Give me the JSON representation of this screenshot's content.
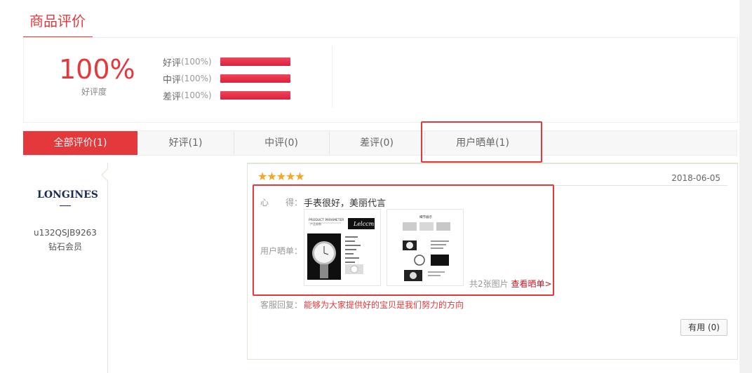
{
  "section": {
    "title": "商品评价"
  },
  "summary": {
    "rate": "100%",
    "rate_label": "好评度",
    "breakdown": [
      {
        "name": "好评",
        "pct_label": "(100%)",
        "fill": 1.0
      },
      {
        "name": "中评",
        "pct_label": "(100%)",
        "fill": 1.0
      },
      {
        "name": "差评",
        "pct_label": "(100%)",
        "fill": 1.0
      }
    ]
  },
  "tabs": [
    {
      "label": "全部评价(1)"
    },
    {
      "label": "好评(1)"
    },
    {
      "label": "中评(0)"
    },
    {
      "label": "差评(0)"
    },
    {
      "label": "用户晒单(1)"
    }
  ],
  "user": {
    "logo": "LONGINES",
    "name": "u132QSJB9263",
    "level": "钻石会员"
  },
  "review": {
    "stars": "★★★★★",
    "date": "2018-06-05",
    "comment_label": "心　　得：",
    "comment": "手表很好，美丽代言",
    "photos_label": "用户晒单：",
    "photo_count": "共2张图片",
    "view_link": "查看晒单>",
    "photo1_text": "PRODUCT PARAMETER",
    "photo1_sub": "产品参数",
    "photo2_text": "细节展示",
    "reply_label": "客服回复：",
    "reply": "能够为大家提供好的宝贝是我们努力的方向",
    "useful_label": "有用 (0)"
  },
  "colors": {
    "accent": "#e4393c",
    "star": "#f5a623"
  }
}
